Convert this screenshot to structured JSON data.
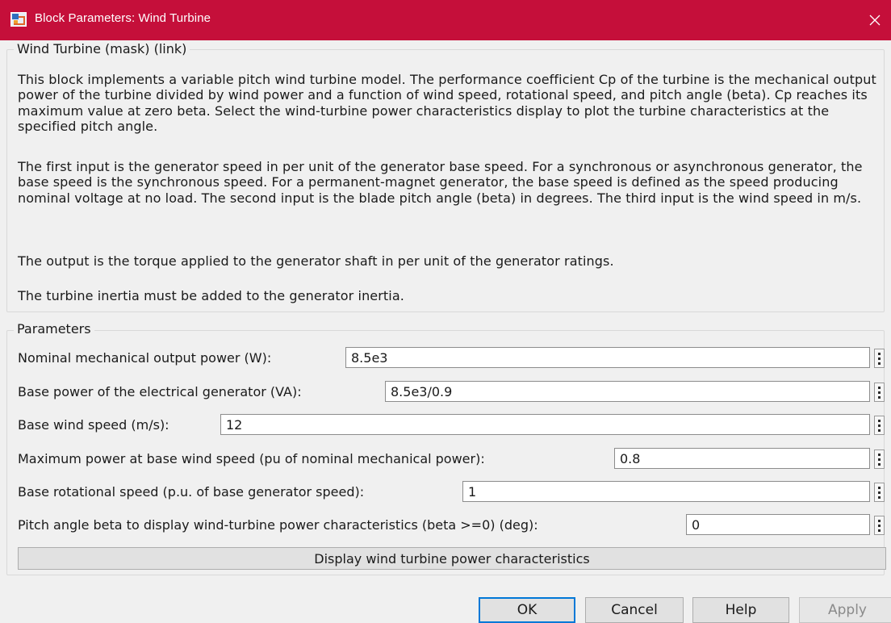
{
  "window": {
    "title": "Block Parameters: Wind Turbine",
    "titlebar_color": "#c50f3a",
    "icon": "simulink-block-icon",
    "close_icon": "close-icon"
  },
  "mask": {
    "legend": "Wind Turbine (mask) (link)",
    "paragraphs": [
      "This block implements a variable pitch wind turbine model. The performance coefficient Cp of the turbine is the mechanical output power of the turbine divided by wind power and a function of wind speed, rotational speed, and pitch angle (beta). Cp reaches its maximum value at zero beta. Select the wind-turbine power characteristics display to plot the turbine characteristics at the specified pitch angle.",
      "The first input is the generator speed in per unit of the generator base speed. For a synchronous or asynchronous generator, the base speed is the synchronous speed. For a permanent-magnet generator, the base speed is defined as the speed producing nominal voltage at  no load. The second input is the blade pitch angle (beta) in degrees. The third input is the wind speed in m/s.",
      "The output is the torque applied to the generator shaft in per unit of the generator ratings.",
      "The turbine inertia must be added to the generator inertia."
    ]
  },
  "params": {
    "legend": "Parameters",
    "fields": [
      {
        "label": "Nominal mechanical output power (W):",
        "value": "8.5e3"
      },
      {
        "label": "Base power of the electrical generator (VA):",
        "value": "8.5e3/0.9"
      },
      {
        "label": "Base wind speed (m/s):",
        "value": "12"
      },
      {
        "label": "Maximum power at base wind speed (pu of nominal mechanical power):",
        "value": "0.8"
      },
      {
        "label": "Base rotational speed (p.u. of base generator speed):",
        "value": "1"
      },
      {
        "label": "Pitch angle beta to display wind-turbine power characteristics (beta >=0)  (deg):",
        "value": "0"
      }
    ],
    "display_button": "Display wind turbine power characteristics"
  },
  "buttons": {
    "ok": "OK",
    "cancel": "Cancel",
    "help": "Help",
    "apply": "Apply"
  }
}
